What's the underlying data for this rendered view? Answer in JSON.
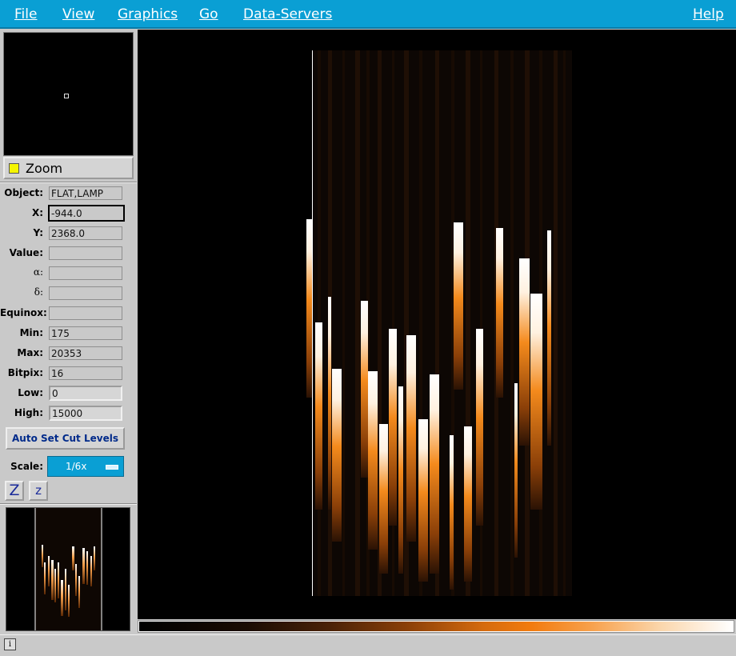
{
  "menubar": {
    "file": "File",
    "view": "View",
    "graphics": "Graphics",
    "go": "Go",
    "data_servers": "Data-Servers",
    "help": "Help"
  },
  "zoom": {
    "label": "Zoom",
    "indicator_color": "#f5f500"
  },
  "info_panel": {
    "object": {
      "label": "Object:",
      "value": "FLAT,LAMP"
    },
    "x": {
      "label": "X:",
      "value": "-944.0"
    },
    "y": {
      "label": "Y:",
      "value": "2368.0"
    },
    "value": {
      "label": "Value:",
      "value": ""
    },
    "alpha": {
      "label": "α:",
      "value": ""
    },
    "delta": {
      "label": "δ:",
      "value": ""
    },
    "equinox": {
      "label": "Equinox:",
      "value": ""
    },
    "min": {
      "label": "Min:",
      "value": "175"
    },
    "max": {
      "label": "Max:",
      "value": "20353"
    },
    "bitpix": {
      "label": "Bitpix:",
      "value": "16"
    },
    "low": {
      "label": "Low:",
      "value": "0"
    },
    "high": {
      "label": "High:",
      "value": "15000"
    }
  },
  "cut_levels": {
    "auto_label": "Auto Set Cut Levels"
  },
  "scale": {
    "label": "Scale:",
    "value": "1/6x"
  },
  "zoom_buttons": {
    "zoom_in": "Z",
    "zoom_out": "z"
  },
  "status": {
    "icon": "info-icon",
    "text": ""
  },
  "colors": {
    "menubar": "#0a9fd4",
    "accent_orange": "#f27b0f",
    "panel_bg": "#c9c9c9",
    "image_bg": "#000000"
  }
}
